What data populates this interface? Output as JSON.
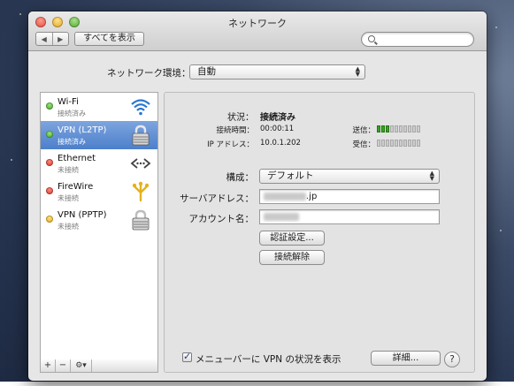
{
  "window": {
    "title": "ネットワーク",
    "show_all_label": "すべてを表示",
    "search_placeholder": ""
  },
  "location": {
    "label": "ネットワーク環境：",
    "value": "自動"
  },
  "services": [
    {
      "name": "Wi-Fi",
      "status": "接続済み",
      "dot": "green",
      "icon": "wifi-icon",
      "selected": false
    },
    {
      "name": "VPN (L2TP)",
      "status": "接続済み",
      "dot": "green",
      "icon": "lock-icon",
      "selected": true
    },
    {
      "name": "Ethernet",
      "status": "未接続",
      "dot": "red",
      "icon": "ethernet-icon",
      "selected": false
    },
    {
      "name": "FireWire",
      "status": "未接続",
      "dot": "red",
      "icon": "firewire-icon",
      "selected": false
    },
    {
      "name": "VPN (PPTP)",
      "status": "未接続",
      "dot": "yellow",
      "icon": "lock-icon",
      "selected": false
    }
  ],
  "sidebar_controls": {
    "add": "+",
    "remove": "−",
    "gear": "⚙▾"
  },
  "detail": {
    "status_label": "状況：",
    "status_value": "接続済み",
    "conn_time_label": "接続時間：",
    "conn_time_value": "00:00:11",
    "ip_label": "IP アドレス：",
    "ip_value": "10.0.1.202",
    "send_label": "送信：",
    "recv_label": "受信：",
    "send_level": 0.3,
    "recv_level": 0.0,
    "config_label": "構成：",
    "config_value": "デフォルト",
    "server_label": "サーバアドレス：",
    "server_value_suffix": ".jp",
    "account_label": "アカウント名：",
    "auth_button": "認証設定...",
    "disconnect_button": "接続解除",
    "menubar_checkbox_label": "メニューバーに VPN の状況を表示",
    "menubar_checked": true,
    "advanced_button": "詳細...",
    "help_button": "?"
  },
  "colors": {
    "selection": "#4c7fcb",
    "meter_on": "#39a325",
    "dot_green": "#34a31b",
    "dot_red": "#d3281d",
    "dot_yellow": "#e0a10f"
  }
}
